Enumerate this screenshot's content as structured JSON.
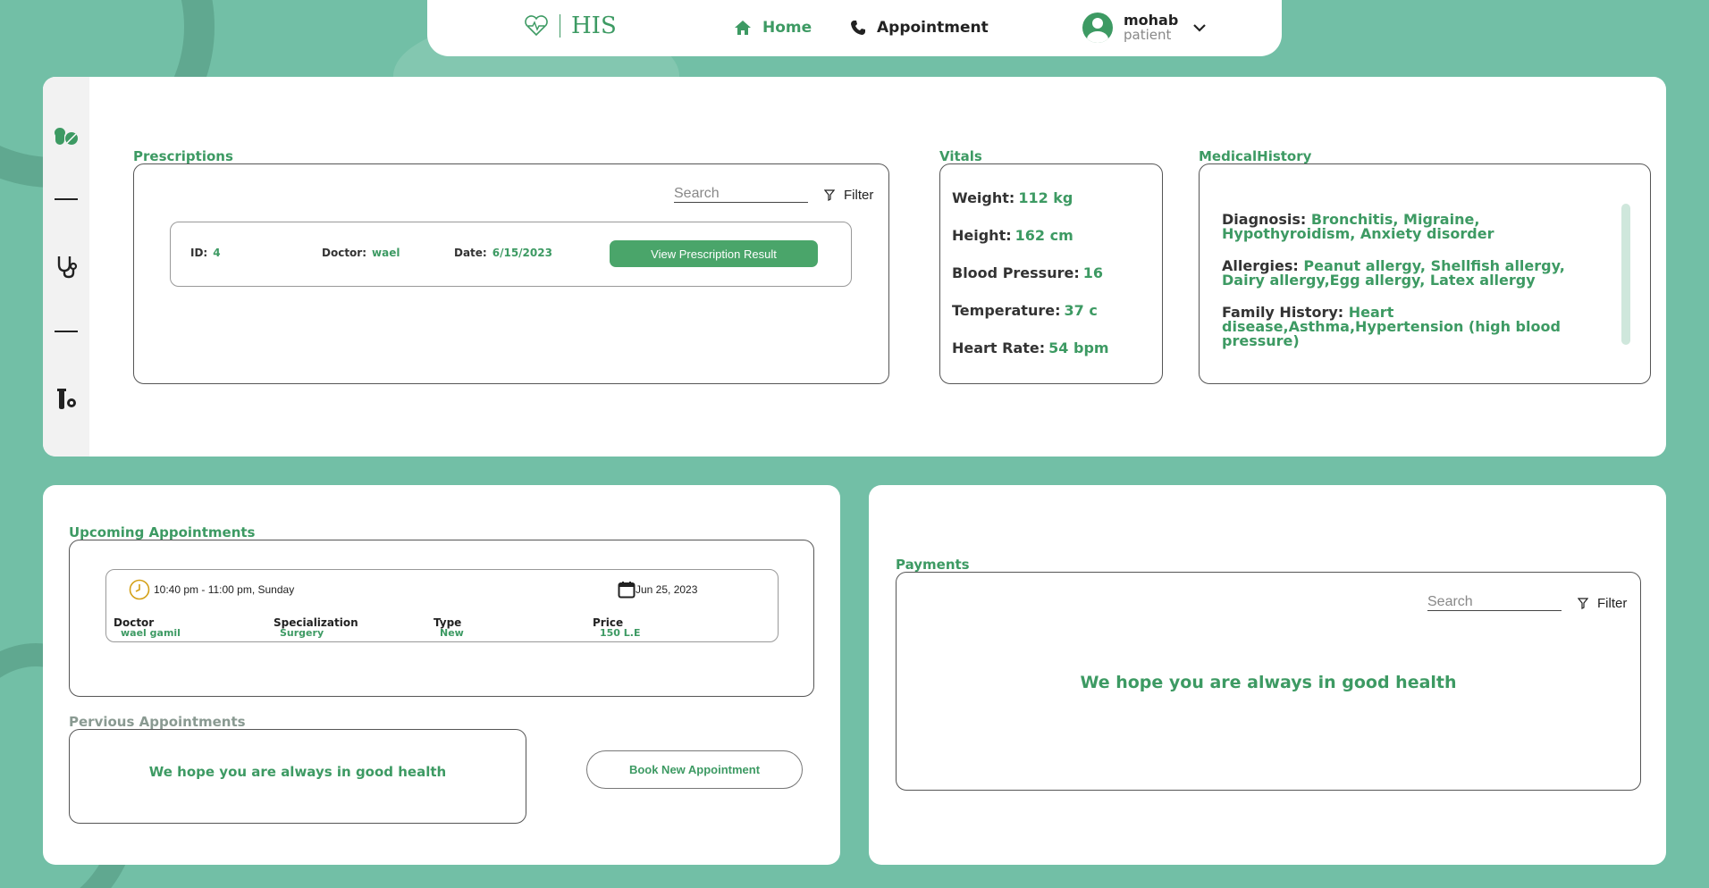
{
  "nav": {
    "logo_text": "HIS",
    "home_label": "Home",
    "appointment_label": "Appointment",
    "user_name": "mohab",
    "user_role": "patient"
  },
  "prescriptions": {
    "title": "Prescriptions",
    "search_placeholder": "Search",
    "filter_label": "Filter",
    "item": {
      "id_label": "ID:",
      "id_value": "4",
      "doctor_label": "Doctor:",
      "doctor_value": "wael",
      "date_label": "Date:",
      "date_value": "6/15/2023",
      "button_label": "View Prescription Result"
    }
  },
  "vitals": {
    "title": "Vitals",
    "items": [
      {
        "label": "Weight:",
        "value": "112 kg"
      },
      {
        "label": "Height:",
        "value": "162 cm"
      },
      {
        "label": "Blood Pressure:",
        "value": "16"
      },
      {
        "label": "Temperature:",
        "value": "37 c"
      },
      {
        "label": "Heart Rate:",
        "value": "54 bpm"
      }
    ]
  },
  "medical_history": {
    "title": "MedicalHistory",
    "items": [
      {
        "label": "Diagnosis:",
        "value": "Bronchitis, Migraine, Hypothyroidism, Anxiety disorder"
      },
      {
        "label": "Allergies:",
        "value": "Peanut allergy, Shellfish allergy, Dairy allergy,Egg allergy, Latex allergy"
      },
      {
        "label": "Family History:",
        "value": "Heart disease,Asthma,Hypertension (high blood pressure)"
      }
    ]
  },
  "upcoming": {
    "title": "Upcoming Appointments",
    "time": "10:40 pm - 11:00 pm, Sunday",
    "date": "Jun 25, 2023",
    "doctor_label": "Doctor",
    "doctor_value": "wael gamil",
    "spec_label": "Specialization",
    "spec_value": "Surgery",
    "type_label": "Type",
    "type_value": "New",
    "price_label": "Price",
    "price_value": "150 L.E"
  },
  "previous": {
    "title": "Pervious Appointments",
    "message": "We hope you are always in good health",
    "book_button": "Book New Appointment"
  },
  "payments": {
    "title": "Payments",
    "search_placeholder": "Search",
    "filter_label": "Filter",
    "message": "We hope you are always in good health"
  },
  "colors": {
    "accent": "#3d9a63",
    "background": "#72bfa6",
    "button": "#4aa56a"
  }
}
